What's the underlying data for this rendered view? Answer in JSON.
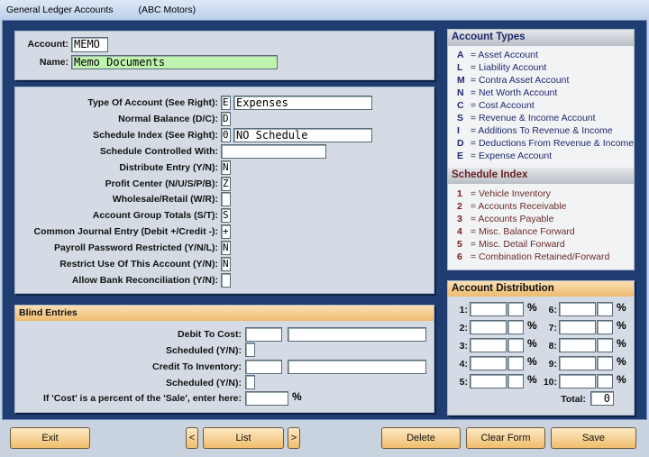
{
  "window": {
    "title": "General Ledger Accounts",
    "company": "(ABC Motors)"
  },
  "header": {
    "account_label": "Account:",
    "account_value": "MEMO",
    "name_label": "Name:",
    "name_value": "Memo Documents"
  },
  "form": {
    "rows": [
      {
        "label": "Type Of Account (See Right):",
        "code": "E",
        "desc": "Expenses"
      },
      {
        "label": "Normal Balance (D/C):",
        "code": "D"
      },
      {
        "label": "Schedule Index (See Right):",
        "code": "0",
        "desc": "NO Schedule"
      },
      {
        "label": "Schedule Controlled With:",
        "value": ""
      },
      {
        "label": "Distribute Entry (Y/N):",
        "code": "N"
      },
      {
        "label": "Profit Center (N/U/S/P/B):",
        "code": "Z"
      },
      {
        "label": "Wholesale/Retail (W/R):",
        "code": ""
      },
      {
        "label": "Account Group Totals (S/T):",
        "code": "S"
      },
      {
        "label": "Common Journal Entry (Debit +/Credit -):",
        "code": "+"
      },
      {
        "label": "Payroll Password Restricted (Y/N/L):",
        "code": "N"
      },
      {
        "label": "Restrict Use Of This Account (Y/N):",
        "code": "N"
      },
      {
        "label": "Allow Bank Reconciliation (Y/N):",
        "code": ""
      }
    ]
  },
  "blind": {
    "title": "Blind Entries",
    "debit_label": "Debit To Cost:",
    "sched1_label": "Scheduled (Y/N):",
    "credit_label": "Credit To Inventory:",
    "sched2_label": "Scheduled (Y/N):",
    "percent_label": "If 'Cost' is a percent of the 'Sale', enter here:",
    "percent_sign": "%"
  },
  "account_types": {
    "title": "Account Types",
    "items": [
      {
        "k": "A",
        "v": "= Asset Account"
      },
      {
        "k": "L",
        "v": "= Liability Account"
      },
      {
        "k": "M",
        "v": "= Contra Asset Account"
      },
      {
        "k": "N",
        "v": "= Net Worth Account"
      },
      {
        "k": "C",
        "v": "= Cost Account"
      },
      {
        "k": "S",
        "v": "= Revenue & Income Account"
      },
      {
        "k": "I",
        "v": "= Additions To Revenue & Income"
      },
      {
        "k": "D",
        "v": "= Deductions From Revenue & Income"
      },
      {
        "k": "E",
        "v": "= Expense Account"
      }
    ]
  },
  "schedule_index": {
    "title": "Schedule Index",
    "items": [
      {
        "k": "1",
        "v": "= Vehicle Inventory"
      },
      {
        "k": "2",
        "v": "= Accounts Receivable"
      },
      {
        "k": "3",
        "v": "= Accounts Payable"
      },
      {
        "k": "4",
        "v": "= Misc. Balance Forward"
      },
      {
        "k": "5",
        "v": "= Misc. Detail Forward"
      },
      {
        "k": "6",
        "v": "= Combination Retained/Forward"
      }
    ]
  },
  "distribution": {
    "title": "Account Distribution",
    "labels": [
      "1:",
      "2:",
      "3:",
      "4:",
      "5:",
      "6:",
      "7:",
      "8:",
      "9:",
      "10:"
    ],
    "percent_sign": "%",
    "total_label": "Total:",
    "total_value": "0"
  },
  "buttons": {
    "exit": "Exit",
    "prev": "<",
    "list": "List",
    "next": ">",
    "delete": "Delete",
    "clear": "Clear Form",
    "save": "Save"
  },
  "colors": {
    "window_bg": "#1f3d70",
    "panel_bg": "#d4dbe4",
    "accent_orange": "#f0bd6c",
    "name_field": "#bff4b0",
    "types_key": "#1e2a6e",
    "schedule_key": "#7a1a1a"
  }
}
